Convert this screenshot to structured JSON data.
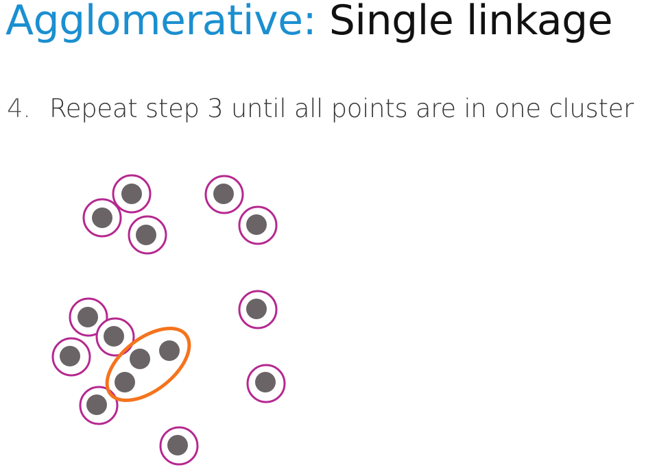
{
  "slide": {
    "title_accent": "Agglomerative:",
    "title_main": "Single linkage",
    "step_number": "4.",
    "step_text": "Repeat step 3 until all points are in one cluster"
  },
  "diagram": {
    "colors": {
      "point_fill": "#6b6466",
      "singleton_ring": "#b5288f",
      "merged_cluster_ring": "#f5731d"
    }
  }
}
